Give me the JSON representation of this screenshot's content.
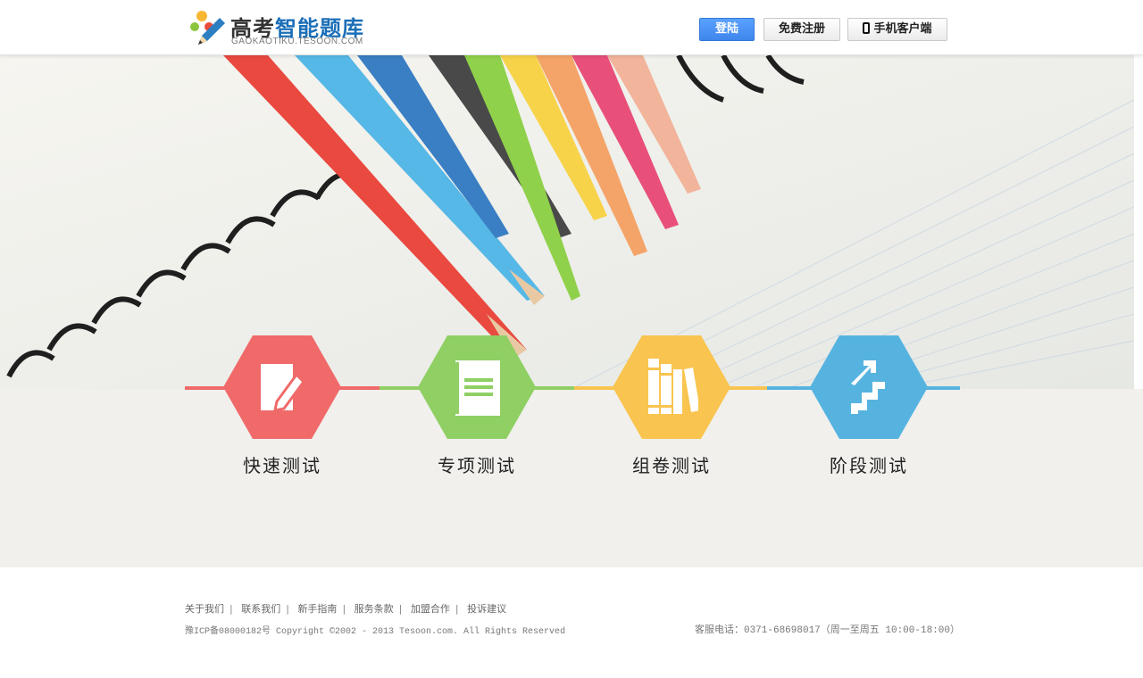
{
  "brand": {
    "title_part1": "高考",
    "title_part2": "智能题库",
    "subtitle": "GAOKAOTIKU.TESOON.COM"
  },
  "header": {
    "login_label": "登陆",
    "register_label": "免费注册",
    "mobile_label": "手机客户端"
  },
  "features": [
    {
      "label": "快速测试",
      "color": "#f06a6a",
      "icon": "edit-document-icon"
    },
    {
      "label": "专项测试",
      "color": "#8fcf63",
      "icon": "book-icon"
    },
    {
      "label": "组卷测试",
      "color": "#f9c44f",
      "icon": "books-on-shelf-icon"
    },
    {
      "label": "阶段测试",
      "color": "#56b3e0",
      "icon": "stairs-up-icon"
    }
  ],
  "footer": {
    "links": [
      "关于我们",
      "联系我们",
      "新手指南",
      "服务条款",
      "加盟合作",
      "投诉建议"
    ],
    "copyright": "豫ICP备08000182号 Copyright ©2002 - 2013 Tesoon.com. All Rights Reserved",
    "phone": "客服电话：0371-68698017（周一至周五 10:00-18:00）"
  }
}
